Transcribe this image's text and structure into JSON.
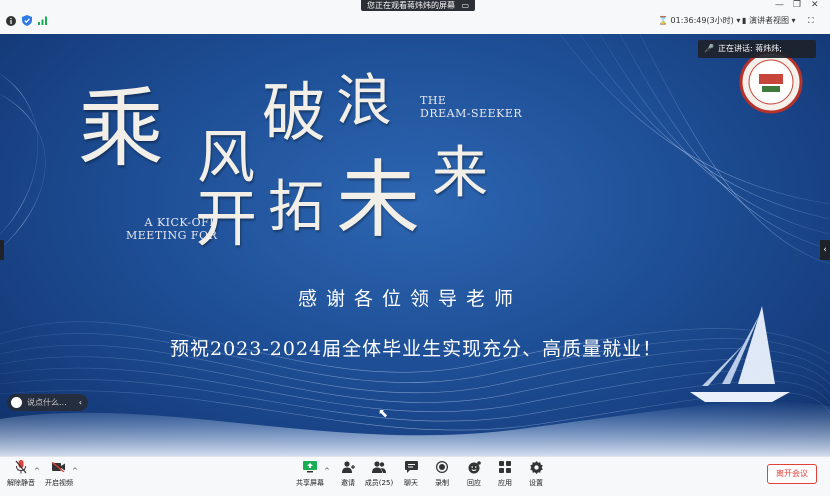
{
  "share_tip": {
    "text": "您正在观看蒋炜炜的屏幕",
    "icon": "screen-share-icon"
  },
  "window_controls": [
    "minimize-icon",
    "restore-icon",
    "close-icon"
  ],
  "topbar": {
    "timer": "01:36:49(3小时)",
    "view_label": "演讲者视图",
    "icons": [
      "info-icon",
      "shield-icon",
      "signal-icon",
      "hourglass-icon",
      "view-icon",
      "fullscreen-icon"
    ]
  },
  "slide": {
    "title_chars": [
      "乘",
      "风",
      "破",
      "浪",
      "开",
      "拓",
      "未",
      "来"
    ],
    "en_dream": [
      "THE",
      "DREAM-SEEKER"
    ],
    "en_kickoff": [
      "A KICK-OFF",
      "MEETING FOR"
    ],
    "thanks": "感谢各位领导老师",
    "wish": "预祝2023-2024届全体毕业生实现充分、高质量就业！",
    "background": "#1e4f96"
  },
  "speaker": {
    "label": "正在讲话: 蒋炜炜;",
    "icon": "mic-icon"
  },
  "chat": {
    "placeholder": "说点什么...",
    "icon": "emoji-icon"
  },
  "toolbar": {
    "unmute": "解除静音",
    "video": "开启视频",
    "share": "共享屏幕",
    "invite": "邀请",
    "members": "成员(25)",
    "chat": "聊天",
    "record": "录制",
    "replay": "回应",
    "apps": "应用",
    "settings": "设置",
    "leave": "离开会议"
  },
  "colors": {
    "leave": "#e0413a",
    "share_active": "#1aad53",
    "mute_red": "#e0413a"
  }
}
